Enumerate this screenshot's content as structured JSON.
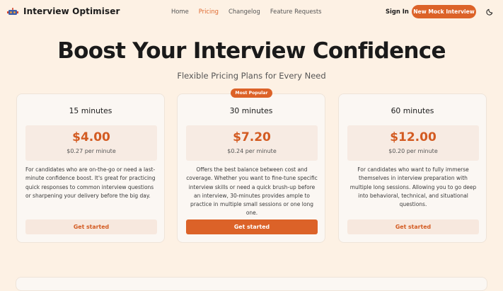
{
  "header": {
    "brand": "Interview Optimiser",
    "nav": [
      "Home",
      "Pricing",
      "Changelog",
      "Feature Requests"
    ],
    "active_nav": "Pricing",
    "sign_in": "Sign In",
    "cta": "New Mock Interview",
    "theme_icon": "moon-icon",
    "logo_icon": "brand-logo-icon"
  },
  "hero": {
    "title": "Boost Your Interview Confidence",
    "subtitle": "Flexible Pricing Plans for Every Need"
  },
  "plans": [
    {
      "name": "15 minutes",
      "price": "$4.00",
      "per_minute": "$0.27 per minute",
      "description": "For candidates who are on-the-go or need a last-minute confidence boost. It's great for practicing quick responses to common interview questions or sharpening your delivery before the big day.",
      "button": "Get started"
    },
    {
      "name": "30 minutes",
      "badge": "Most Popular",
      "price": "$7.20",
      "per_minute": "$0.24 per minute",
      "description": "Offers the best balance between cost and coverage. Whether you want to fine-tune specific interview skills or need a quick brush-up before an interview, 30-minutes provides ample to practice in multiple small sessions or one long one.",
      "button": "Get started"
    },
    {
      "name": "60 minutes",
      "price": "$12.00",
      "per_minute": "$0.20 per minute",
      "description": "For candidates who want to fully immerse themselves in interview preparation with multiple long sessions. Allowing you to go deep into behavioral, technical, and situational questions.",
      "button": "Get started"
    }
  ],
  "colors": {
    "accent": "#dc6228",
    "background": "#fdf1e4",
    "card": "#fbf7f3"
  }
}
